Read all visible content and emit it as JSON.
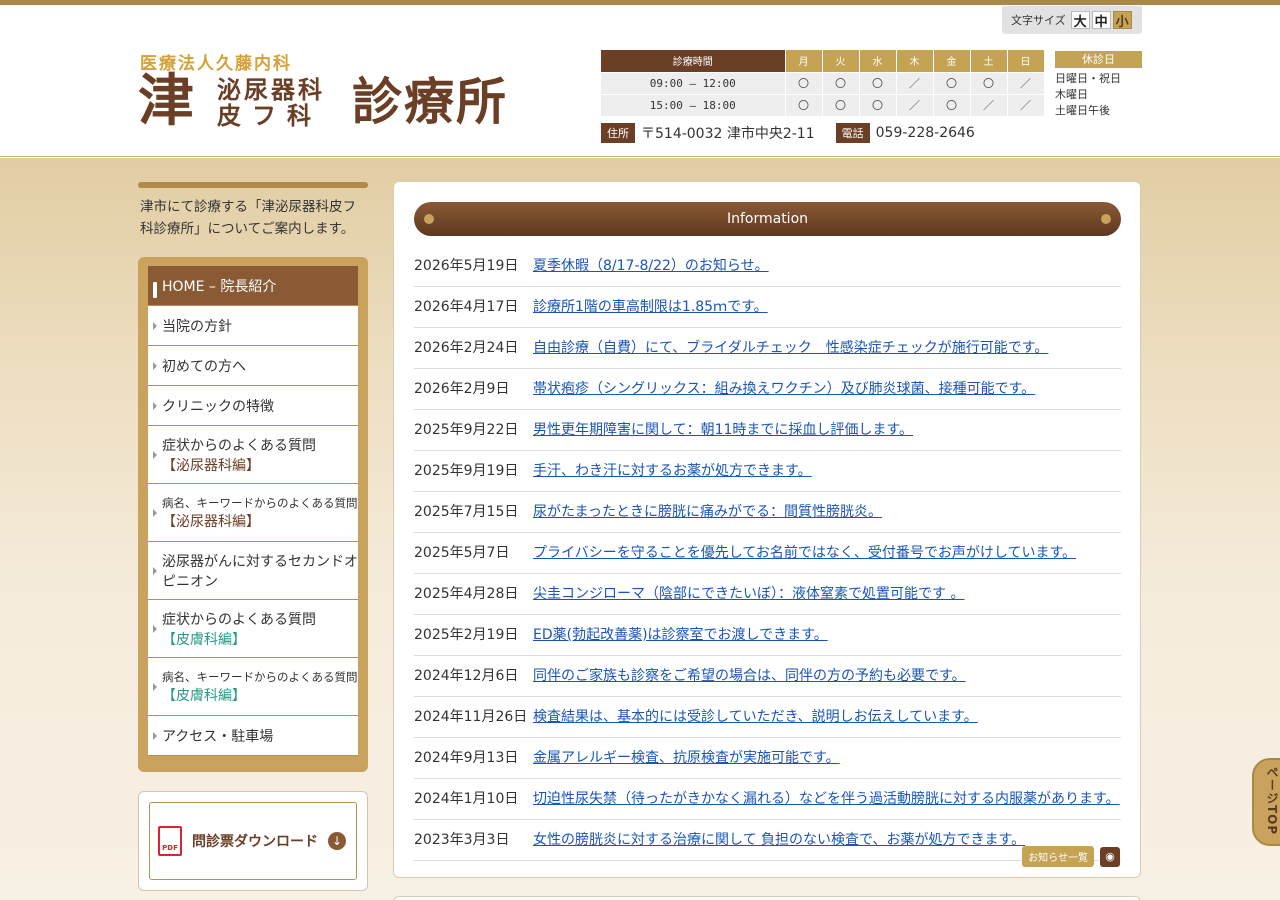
{
  "fontsize": {
    "label": "文字サイズ",
    "large": "大",
    "medium": "中",
    "small": "小"
  },
  "logo": {
    "corp": "医療法人久藤内科",
    "tsu": "津",
    "dept1": "泌尿器科",
    "dept2": "皮フ科",
    "main": "診療所"
  },
  "hours": {
    "caption": "診療時間",
    "days": [
      "月",
      "火",
      "水",
      "木",
      "金",
      "土",
      "日"
    ],
    "rows": [
      {
        "time": "09:00 – 12:00",
        "marks": [
          "〇",
          "〇",
          "〇",
          "／",
          "〇",
          "〇",
          "／"
        ]
      },
      {
        "time": "15:00 – 18:00",
        "marks": [
          "〇",
          "〇",
          "〇",
          "／",
          "〇",
          "／",
          "／"
        ]
      }
    ]
  },
  "holiday": {
    "title": "休診日",
    "items": [
      "日曜日・祝日",
      "木曜日",
      "土曜日午後"
    ]
  },
  "address": {
    "label": "住所",
    "value": "〒514-0032 津市中央2-11",
    "tel_label": "電話",
    "tel": "059-228-2646"
  },
  "intro": "津市にて診療する「津泌尿器科皮フ科診療所」についてご案内します。",
  "nav": {
    "home": "HOME – 院長紹介",
    "policy": "当院の方針",
    "first": "初めての方へ",
    "features": "クリニックの特徴",
    "faq_symptom_uro": "症状からのよくある質問",
    "faq_symptom_uro_sub": "【泌尿器科編】",
    "faq_keyword_uro": "病名、キーワードからのよくある質問",
    "faq_keyword_uro_sub": "【泌尿器科編】",
    "second_opinion": "泌尿器がんに対するセカンドオピニオン",
    "faq_symptom_derm": "症状からのよくある質問",
    "faq_symptom_derm_sub": "【皮膚科編】",
    "faq_keyword_derm": "病名、キーワードからのよくある質問",
    "faq_keyword_derm_sub": "【皮膚科編】",
    "access": "アクセス・駐車場"
  },
  "download": {
    "label": "問診票ダウンロード",
    "pdf": "PDF"
  },
  "info": {
    "title": "Information",
    "items": [
      {
        "date": "2026年5月19日",
        "text": "夏季休暇（8/17-8/22）のお知らせ。"
      },
      {
        "date": "2026年4月17日",
        "text": "診療所1階の車高制限は1.85ｍです。"
      },
      {
        "date": "2026年2月24日",
        "text": "自由診療（自費）にて、ブライダルチェック　性感染症チェックが施行可能です。"
      },
      {
        "date": "2026年2月9日",
        "text": "帯状疱疹（シングリックス：組み換えワクチン）及び肺炎球菌、接種可能です。"
      },
      {
        "date": "2025年9月22日",
        "text": "男性更年期障害に関して：朝11時までに採血し評価します。"
      },
      {
        "date": "2025年9月19日",
        "text": "手汗、わき汗に対するお薬が処方できます。"
      },
      {
        "date": "2025年7月15日",
        "text": "尿がたまったときに膀胱に痛みがでる：間質性膀胱炎。"
      },
      {
        "date": "2025年5月7日",
        "text": "プライバシーを守ることを優先してお名前ではなく、受付番号でお声がけしています。"
      },
      {
        "date": "2025年4月28日",
        "text": "尖圭コンジローマ（陰部にできたいぼ）：液体窒素で処置可能です 。"
      },
      {
        "date": "2025年2月19日",
        "text": "ED薬(勃起改善薬)は診察室でお渡しできます。"
      },
      {
        "date": "2024年12月6日",
        "text": "同伴のご家族も診察をご希望の場合は、同伴の方の予約も必要です。"
      },
      {
        "date": "2024年11月26日",
        "text": "検査結果は、基本的には受診していただき、説明しお伝えしています。"
      },
      {
        "date": "2024年9月13日",
        "text": "金属アレルギー検査、抗原検査が実施可能です。"
      },
      {
        "date": "2024年1月10日",
        "text": "切迫性尿失禁（待ったがきかなく漏れる）などを伴う過活動膀胱に対する内服薬があります。"
      },
      {
        "date": "2023年3月3日",
        "text": "女性の膀胱炎に対する治療に関して 負担のない検査で、お薬が処方できます。"
      }
    ],
    "list_button": "お知らせ一覧"
  },
  "pagetop": "ページTOP",
  "colors": {
    "brand": "#6b3e26",
    "accent": "#c4a453",
    "link": "#1a55b8"
  }
}
